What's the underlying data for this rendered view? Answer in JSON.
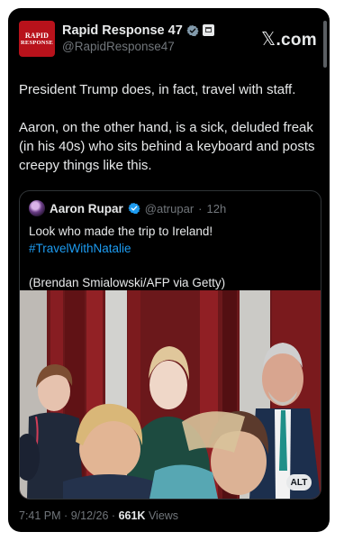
{
  "author": {
    "display_name": "Rapid Response 47",
    "handle": "@RapidResponse47",
    "avatar_text_top": "RAPID",
    "avatar_text_bottom": "RESPONSE",
    "verified_color": "#829aab",
    "avatar_color": "#b8121b"
  },
  "brand": {
    "x_icon": "𝕏",
    "label": ".com"
  },
  "post": {
    "paragraphs": [
      "President Trump does, in fact, travel with staff.",
      "Aaron, on the other hand, is a sick, deluded freak (in his 40s) who sits behind a keyboard and posts creepy things like this."
    ]
  },
  "quoted_post": {
    "display_name": "Aaron Rupar",
    "handle": "@atrupar",
    "separator": "·",
    "time": "12h",
    "text": "Look who made the trip to Ireland!",
    "hashtag": "#TravelWithNatalie",
    "credit": "(Brendan Smialowski/AFP via Getty)",
    "verified_color": "#1d9bf0",
    "image": {
      "alt_label": "ALT"
    }
  },
  "meta": {
    "time": "7:41 PM",
    "separator": "·",
    "date": "9/12/26",
    "views_count": "661K",
    "views_label": "Views"
  }
}
